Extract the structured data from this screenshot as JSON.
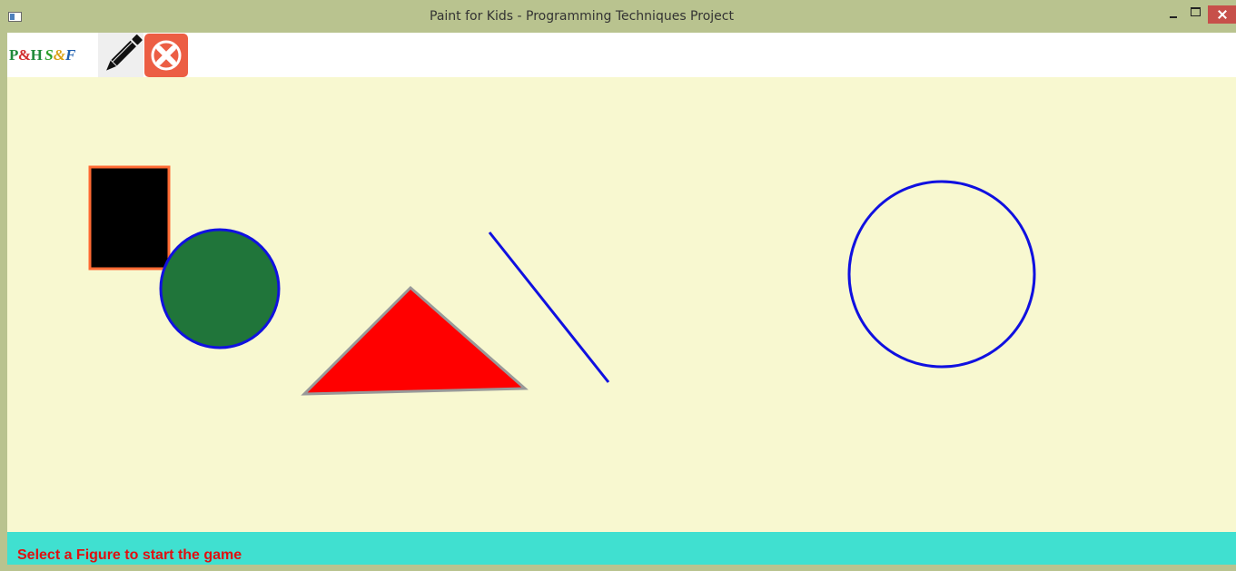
{
  "window": {
    "title": "Paint for Kids - Programming Techniques Project",
    "icons": {
      "app": "app-window-icon",
      "minimize": "minimize-icon",
      "maximize": "maximize-icon",
      "close": "close-icon"
    }
  },
  "toolbar": {
    "items": [
      {
        "name": "figures-logo",
        "label_ph": "P&H",
        "label_sf": "S&F",
        "icon": "pick-and-hide-logo-icon"
      },
      {
        "name": "draw-mode",
        "icon": "pencil-icon"
      },
      {
        "name": "exit",
        "icon": "close-x-icon"
      }
    ]
  },
  "canvas": {
    "background": "#f8f8d0",
    "figures": [
      {
        "type": "rectangle",
        "fill": "#000000",
        "border": "#ff6a33"
      },
      {
        "type": "circle",
        "fill": "#20753a",
        "border": "#1010e0"
      },
      {
        "type": "triangle",
        "fill": "#ff0000",
        "border": "#999999"
      },
      {
        "type": "line",
        "color": "#1010e0"
      },
      {
        "type": "circle",
        "fill": "none",
        "border": "#1010e0"
      }
    ]
  },
  "status": {
    "message": "Select a Figure to start the game",
    "color": "#e01010",
    "background": "#40e0d0"
  }
}
